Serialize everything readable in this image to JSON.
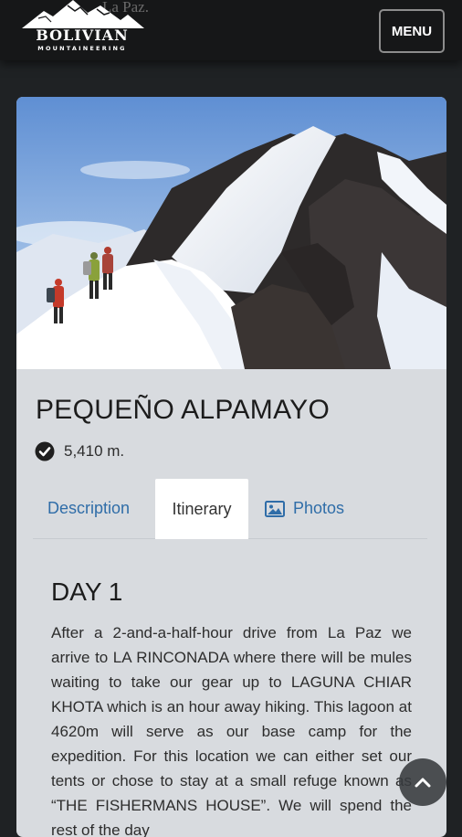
{
  "header": {
    "ghost_text": "La Paz.",
    "logo_word": "BOLIVIAN",
    "logo_sub": "MOUNTAINEERING",
    "menu_label": "MENU"
  },
  "peak": {
    "title": "PEQUEÑO ALPAMAYO",
    "altitude": "5,410 m.",
    "image": "climbers-on-snow-ridge"
  },
  "tabs": [
    {
      "label": "Description",
      "active": false
    },
    {
      "label": "Itinerary",
      "active": true
    },
    {
      "label": "Photos",
      "active": false,
      "icon": "image-icon"
    }
  ],
  "itinerary": {
    "day_title": "DAY 1",
    "text": "After a 2-and-a-half-hour drive from La Paz we arrive to LA RINCONADA where there will be mules waiting to take our gear up to LAGUNA CHIAR KHOTA which is an hour away hiking. This lagoon at 4620m will serve as our base camp for the expedition. For this location we can either set our tents or chose to stay at a small refuge known as “THE FISHERMANS HOUSE”. We will spend the rest of the day"
  },
  "colors": {
    "page_bg": "#1f2224",
    "header_bg": "#161718",
    "card_bg": "#d8dbdf",
    "link": "#2f6da8"
  }
}
